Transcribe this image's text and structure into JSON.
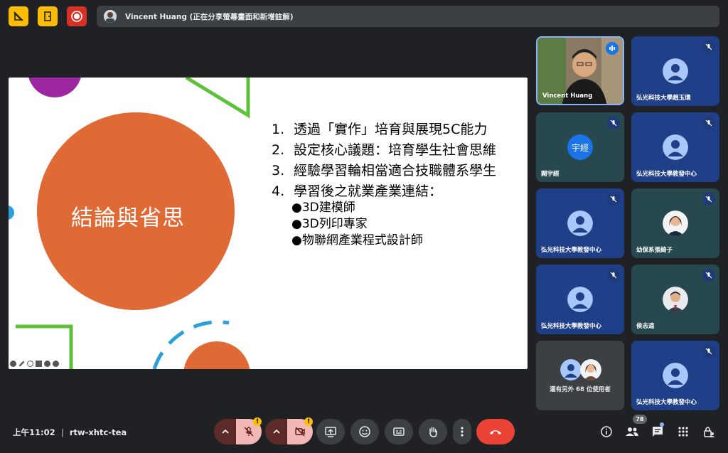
{
  "presenter": {
    "label": "Vincent Huang (正在分享螢幕畫面和新增註解)"
  },
  "slide": {
    "title": "結論與省思",
    "items": [
      {
        "num": "1.",
        "text": "透過「實作」培育與展現5C能力"
      },
      {
        "num": "2.",
        "text": "設定核心議題：培育學生社會思維"
      },
      {
        "num": "3.",
        "text": "經驗學習輪相當適合技職體系學生"
      },
      {
        "num": "4.",
        "text": "學習後之就業產業連結："
      }
    ],
    "subitems": [
      "●3D建模師",
      "●3D列印專家",
      "●物聯網產業程式設計師"
    ]
  },
  "participants": [
    {
      "name": "Vincent Huang"
    },
    {
      "name": "弘光科技大學趙玉環"
    },
    {
      "name": "闕宇經",
      "initials": "宇經"
    },
    {
      "name": "弘光科技大學教發中心"
    },
    {
      "name": "弘光科技大學教發中心"
    },
    {
      "name": "幼保系張綺子"
    },
    {
      "name": "弘光科技大學教發中心"
    },
    {
      "name": "侯志遠"
    },
    {
      "name": "還有另外 68 位使用者"
    },
    {
      "name": "弘光科技大學教發中心"
    }
  ],
  "meeting": {
    "time": "上午11:02",
    "code": "rtw-xhtc-tea",
    "people_count": "78"
  },
  "colors": {
    "bg": "#202124",
    "slide_circle": "#e06a35",
    "end_call": "#ea4335",
    "warning": "#fbbc04",
    "muted_btn": "#f2b8b5"
  }
}
